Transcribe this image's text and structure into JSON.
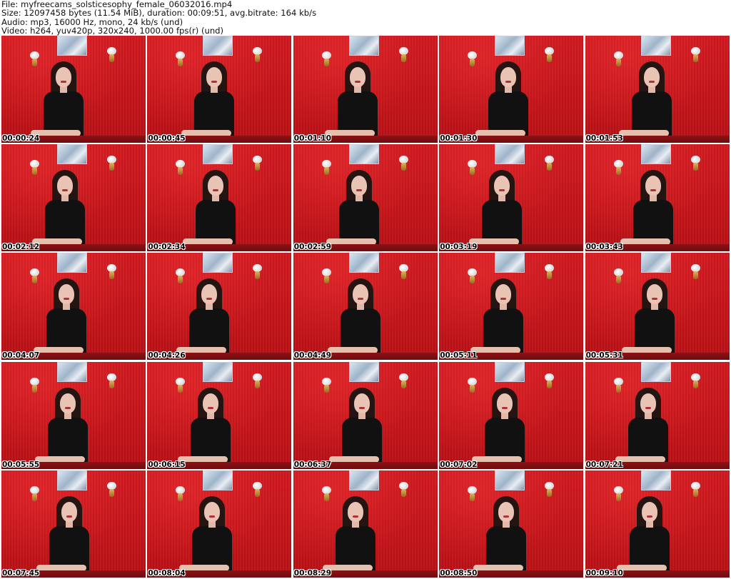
{
  "header": {
    "file": "File: myfreecams_solsticesophy_female_06032016.mp4",
    "size": "Size: 12097458 bytes (11.54 MiB), duration: 00:09:51, avg.bitrate: 164 kb/s",
    "audio": "Audio: mp3, 16000 Hz, mono, 24 kb/s (und)",
    "video": "Video: h264, yuv420p, 320x240, 1000.00 fps(r) (und)"
  },
  "thumbnails": [
    {
      "timestamp": "00:00:24"
    },
    {
      "timestamp": "00:00:45"
    },
    {
      "timestamp": "00:01:10"
    },
    {
      "timestamp": "00:01:30"
    },
    {
      "timestamp": "00:01:53"
    },
    {
      "timestamp": "00:02:12"
    },
    {
      "timestamp": "00:02:34"
    },
    {
      "timestamp": "00:02:59"
    },
    {
      "timestamp": "00:03:19"
    },
    {
      "timestamp": "00:03:43"
    },
    {
      "timestamp": "00:04:07"
    },
    {
      "timestamp": "00:04:26"
    },
    {
      "timestamp": "00:04:49"
    },
    {
      "timestamp": "00:05:11"
    },
    {
      "timestamp": "00:05:31"
    },
    {
      "timestamp": "00:05:55"
    },
    {
      "timestamp": "00:06:15"
    },
    {
      "timestamp": "00:06:37"
    },
    {
      "timestamp": "00:07:02"
    },
    {
      "timestamp": "00:07:21"
    },
    {
      "timestamp": "00:07:45"
    },
    {
      "timestamp": "00:08:04"
    },
    {
      "timestamp": "00:08:29"
    },
    {
      "timestamp": "00:08:50"
    },
    {
      "timestamp": "00:09:10"
    }
  ]
}
